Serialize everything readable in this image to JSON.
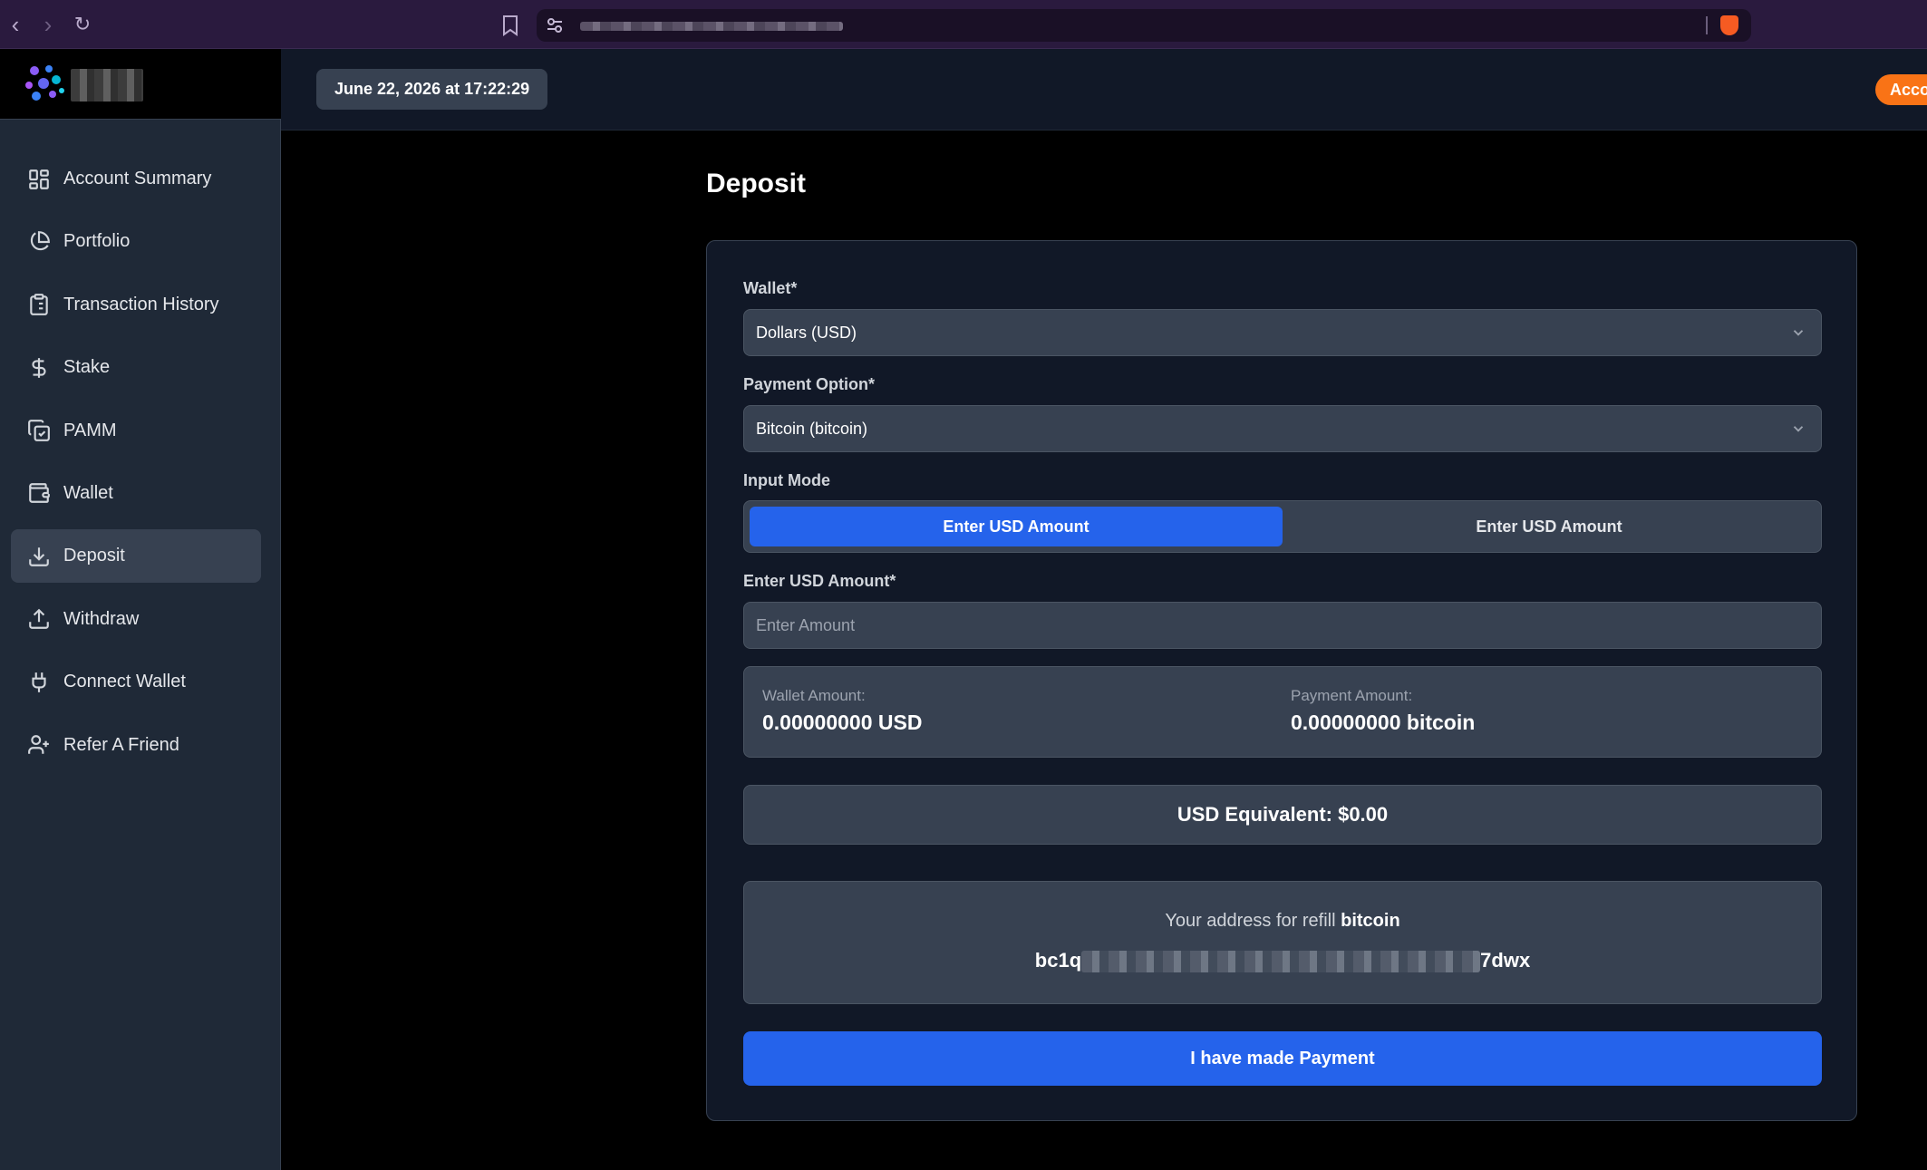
{
  "header": {
    "datetime": "June 22, 2026 at 17:22:29",
    "account_button": "Accou"
  },
  "sidebar": {
    "items": [
      {
        "label": "Account Summary",
        "icon": "dashboard-grid-icon"
      },
      {
        "label": "Portfolio",
        "icon": "pie-chart-icon"
      },
      {
        "label": "Transaction History",
        "icon": "clipboard-list-icon"
      },
      {
        "label": "Stake",
        "icon": "dollar-icon"
      },
      {
        "label": "PAMM",
        "icon": "copy-check-icon"
      },
      {
        "label": "Wallet",
        "icon": "wallet-icon"
      },
      {
        "label": "Deposit",
        "icon": "download-icon",
        "active": true
      },
      {
        "label": "Withdraw",
        "icon": "upload-icon"
      },
      {
        "label": "Connect Wallet",
        "icon": "plug-icon"
      },
      {
        "label": "Refer A Friend",
        "icon": "user-plus-icon"
      }
    ]
  },
  "page": {
    "title": "Deposit"
  },
  "form": {
    "wallet_label": "Wallet*",
    "wallet_value": "Dollars (USD)",
    "payment_label": "Payment Option*",
    "payment_value": "Bitcoin (bitcoin)",
    "input_mode_label": "Input Mode",
    "mode_options": [
      "Enter USD Amount",
      "Enter USD Amount"
    ],
    "amount_label": "Enter USD Amount*",
    "amount_placeholder": "Enter Amount",
    "amount_value": "",
    "wallet_amount_label": "Wallet Amount:",
    "wallet_amount_value": "0.00000000 USD",
    "payment_amount_label": "Payment Amount:",
    "payment_amount_value": "0.00000000 bitcoin",
    "usd_equivalent": "USD Equivalent: $0.00",
    "address_label_prefix": "Your address for refill",
    "address_currency": "bitcoin",
    "address_start": "bc1q",
    "address_end": "7dwx",
    "submit_label": "I have made Payment"
  },
  "colors": {
    "primary": "#2563eb",
    "accent_orange": "#f97316",
    "sidebar_bg": "#1f2937",
    "card_bg": "#111827",
    "field_bg": "#374151"
  }
}
